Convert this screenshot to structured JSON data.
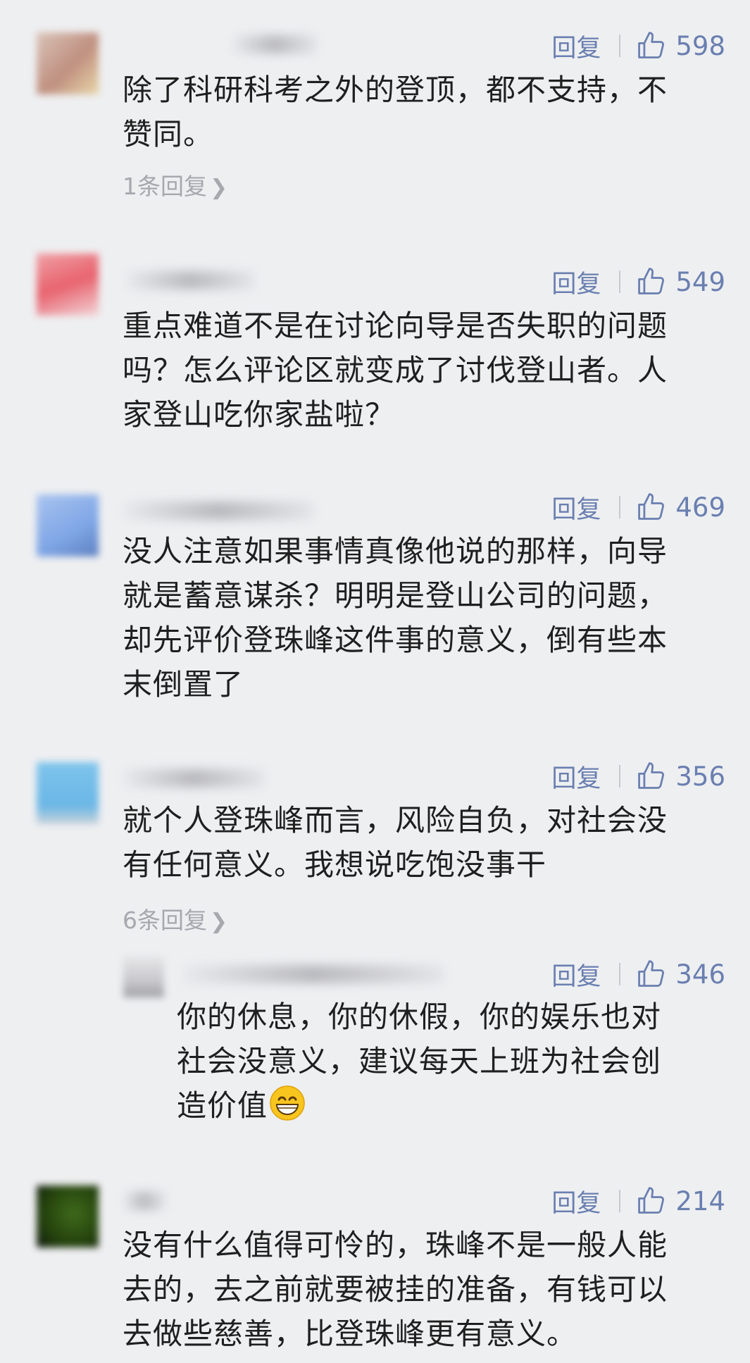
{
  "actions": {
    "reply_label": "回复"
  },
  "comments": [
    {
      "likes": "598",
      "text_lines": [
        "除了科研科考之外的登顶，都不支持，不",
        "赞同。"
      ],
      "more_replies": "1条回复"
    },
    {
      "likes": "549",
      "text_lines": [
        "重点难道不是在讨论向导是否失职的问题",
        "吗？怎么评论区就变成了讨伐登山者。人",
        "家登山吃你家盐啦？"
      ]
    },
    {
      "likes": "469",
      "text_lines": [
        "没人注意如果事情真像他说的那样，向导",
        "就是蓄意谋杀？明明是登山公司的问题，",
        "却先评价登珠峰这件事的意义，倒有些本",
        "末倒置了"
      ]
    },
    {
      "likes": "356",
      "text_lines": [
        "就个人登珠峰而言，风险自负，对社会没",
        "有任何意义。我想说吃饱没事干"
      ],
      "more_replies": "6条回复"
    },
    {
      "likes": "346",
      "text_lines": [
        "你的休息，你的休假，你的娱乐也对",
        "社会没意义，建议每天上班为社会创",
        "造价值"
      ]
    },
    {
      "likes": "214",
      "text_lines": [
        "没有什么值得可怜的，珠峰不是一般人能",
        "去的，去之前就要被挂的准备，有钱可以",
        "去做些慈善，比登珠峰更有意义。"
      ]
    }
  ],
  "icons": {
    "like": "thumbs-up-icon",
    "emoji": "grinning-face-icon"
  },
  "colors": {
    "background": "#eeeff1",
    "action_blue": "#6a7fb0",
    "muted": "#a6a8ae"
  }
}
